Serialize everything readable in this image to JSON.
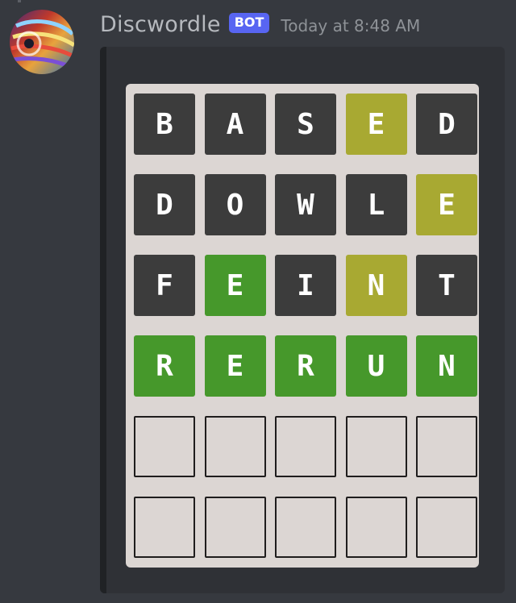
{
  "message": {
    "author": "Discwordle",
    "bot_tag": "BOT",
    "timestamp": "Today at 8:48 AM",
    "avatar_icon": "swirl-avatar-icon"
  },
  "colors": {
    "background": "#36393f",
    "embed_background": "#2f3136",
    "board_background": "#dcd6d3",
    "absent": "#3c3c3c",
    "present": "#a8a932",
    "correct": "#46982b",
    "bot_tag": "#5865f2"
  },
  "board": {
    "rows": [
      {
        "guess": "BASED",
        "tiles": [
          {
            "letter": "B",
            "state": "absent"
          },
          {
            "letter": "A",
            "state": "absent"
          },
          {
            "letter": "S",
            "state": "absent"
          },
          {
            "letter": "E",
            "state": "present"
          },
          {
            "letter": "D",
            "state": "absent"
          }
        ]
      },
      {
        "guess": "DOWLE",
        "tiles": [
          {
            "letter": "D",
            "state": "absent"
          },
          {
            "letter": "O",
            "state": "absent"
          },
          {
            "letter": "W",
            "state": "absent"
          },
          {
            "letter": "L",
            "state": "absent"
          },
          {
            "letter": "E",
            "state": "present"
          }
        ]
      },
      {
        "guess": "FEINT",
        "tiles": [
          {
            "letter": "F",
            "state": "absent"
          },
          {
            "letter": "E",
            "state": "correct"
          },
          {
            "letter": "I",
            "state": "absent"
          },
          {
            "letter": "N",
            "state": "present"
          },
          {
            "letter": "T",
            "state": "absent"
          }
        ]
      },
      {
        "guess": "RERUN",
        "tiles": [
          {
            "letter": "R",
            "state": "correct"
          },
          {
            "letter": "E",
            "state": "correct"
          },
          {
            "letter": "R",
            "state": "correct"
          },
          {
            "letter": "U",
            "state": "correct"
          },
          {
            "letter": "N",
            "state": "correct"
          }
        ]
      },
      {
        "guess": "",
        "tiles": [
          {
            "letter": "",
            "state": "empty"
          },
          {
            "letter": "",
            "state": "empty"
          },
          {
            "letter": "",
            "state": "empty"
          },
          {
            "letter": "",
            "state": "empty"
          },
          {
            "letter": "",
            "state": "empty"
          }
        ]
      },
      {
        "guess": "",
        "tiles": [
          {
            "letter": "",
            "state": "empty"
          },
          {
            "letter": "",
            "state": "empty"
          },
          {
            "letter": "",
            "state": "empty"
          },
          {
            "letter": "",
            "state": "empty"
          },
          {
            "letter": "",
            "state": "empty"
          }
        ]
      }
    ]
  }
}
